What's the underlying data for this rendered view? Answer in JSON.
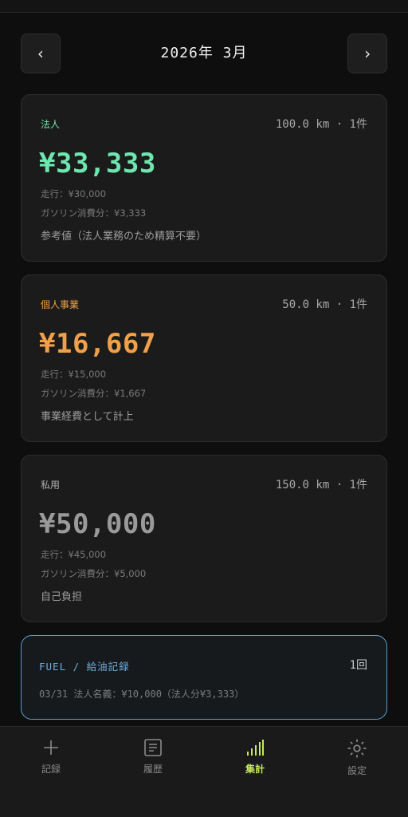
{
  "month_nav": {
    "prev_label": "‹",
    "next_label": "›",
    "current": "2026年 3月"
  },
  "cards": [
    {
      "category": "法人",
      "stats": "100.0 km · 1件",
      "amount": "¥33,333",
      "driving": "走行：¥30,000",
      "fuel": "ガソリン消費分：¥3,333",
      "note": "参考値（法人業務のため精算不要）",
      "color": "#6ee6b0"
    },
    {
      "category": "個人事業",
      "stats": "50.0 km · 1件",
      "amount": "¥16,667",
      "driving": "走行：¥15,000",
      "fuel": "ガソリン消費分：¥1,667",
      "note": "事業経費として計上",
      "color": "#f0a04a"
    },
    {
      "category": "私用",
      "stats": "150.0 km · 1件",
      "amount": "¥50,000",
      "driving": "走行：¥45,000",
      "fuel": "ガソリン消費分：¥5,000",
      "note": "自己負担",
      "color": "#9a9a9a"
    }
  ],
  "fuel": {
    "title": "FUEL / 給油記録",
    "count": "1回",
    "entry": "03/31 法人名義：¥10,000（法人分¥3,333）",
    "accent": "#6aaee0"
  },
  "bottom_nav": [
    {
      "label": "記録",
      "icon": "plus-icon"
    },
    {
      "label": "履歴",
      "icon": "history-icon"
    },
    {
      "label": "集計",
      "icon": "bar-chart-icon",
      "active": true
    },
    {
      "label": "設定",
      "icon": "gear-icon"
    }
  ],
  "colors": {
    "active_nav": "#c6e85a"
  }
}
